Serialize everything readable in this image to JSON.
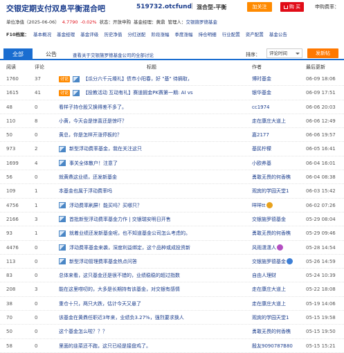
{
  "header": {
    "title": "交银定期支付双息平衡混合吧",
    "code": "519732.otcfund",
    "divider": "|",
    "type": "混合型-平衡",
    "add_label": "加关注",
    "buy_label": "购 买",
    "fee_label": "申购费率："
  },
  "info": {
    "nav_label": "单位净值（2025-06-06）",
    "nav_value": "4.7790",
    "change": "-0.02%",
    "status": "状态：开放申购",
    "manager": "基金经理：黄鼎",
    "company_label": "管理人：",
    "company": "交银施罗德基金"
  },
  "f10": {
    "label": "F10档案：",
    "links": [
      "基本概况",
      "基金经理",
      "基金评级",
      "历史净值",
      "分红送配",
      "阶段涨幅",
      "季度涨幅",
      "持仓明细",
      "行业配置",
      "资产配置",
      "基金公告"
    ]
  },
  "tabs": {
    "all": "全部",
    "announce": "公告",
    "link": "查看关于交银施罗德基金公司的全部讨论",
    "sort_label": "排序：",
    "sort_value": "评论时间",
    "post": "发新帖"
  },
  "columns": {
    "read": "阅读",
    "comment": "评论",
    "title": "标题",
    "author": "作者",
    "time": "最后更新"
  },
  "rows": [
    {
      "read": "1760",
      "cmt": "37",
      "tag": "讨论",
      "img": true,
      "title": "【瓜分六千元壕礼】债市小阳春，好 \"基\" 待摘取，",
      "author": "博时基金",
      "badge": "",
      "time": "06-09 18:06"
    },
    {
      "read": "1615",
      "cmt": "41",
      "tag": "讨论",
      "img": true,
      "title": "【投教活动 互动有礼】赛道掘金PK赛第一期: AI vs",
      "author": "银华基金",
      "badge": "",
      "time": "06-09 17:51"
    },
    {
      "read": "48",
      "cmt": "0",
      "tag": "",
      "img": false,
      "title": "看样子持仓股又换得差不多了。",
      "author": "cc1974",
      "badge": "",
      "time": "06-06 20:03"
    },
    {
      "read": "110",
      "cmt": "8",
      "tag": "",
      "img": false,
      "title": "小黄，今天会是惊喜还是惊吓？",
      "author": "走在康庄大道上",
      "badge": "",
      "time": "06-06 12:49"
    },
    {
      "read": "50",
      "cmt": "0",
      "tag": "",
      "img": false,
      "title": "黄总，你是怎样开涨停板的？",
      "author": "嘉2177",
      "badge": "",
      "time": "06-06 19:57"
    },
    {
      "read": "973",
      "cmt": "2",
      "tag": "",
      "img": true,
      "title": "新型浮动费率基金，我在关注这只",
      "author": "基民柠檬",
      "badge": "",
      "time": "06-05 16:41"
    },
    {
      "read": "1699",
      "cmt": "4",
      "tag": "",
      "img": true,
      "title": "事关全体散户！注意了",
      "author": "小欧养基",
      "badge": "",
      "time": "06-04 16:01"
    },
    {
      "read": "56",
      "cmt": "0",
      "tag": "",
      "img": false,
      "title": "就黄鼎这业绩，还发新基金",
      "author": "勇敢无畏的何香樵",
      "badge": "",
      "time": "06-04 08:38"
    },
    {
      "read": "109",
      "cmt": "1",
      "tag": "",
      "img": false,
      "title": "本基金也属于浮动费率吗",
      "author": "观宾的学园天堂1",
      "badge": "",
      "time": "06-03 15:42"
    },
    {
      "read": "4756",
      "cmt": "1",
      "tag": "",
      "img": true,
      "title": "浮动费率刷屏！能买吗？买哪只？",
      "author": "咩咩tt",
      "badge": "gold",
      "time": "06-02 07:26"
    },
    {
      "read": "2166",
      "cmt": "3",
      "tag": "",
      "img": true,
      "title": "首批新型浮动费率基金力作 | 交银瑞安明日开售",
      "author": "交银施罗德基金",
      "badge": "",
      "time": "05-29 08:04"
    },
    {
      "read": "93",
      "cmt": "1",
      "tag": "",
      "img": true,
      "title": "就着业绩还发新基金呢，也不知道基金公司怎么考虑的。",
      "author": "勇敢无畏的何香樵",
      "badge": "",
      "time": "05-29 09:46"
    },
    {
      "read": "4476",
      "cmt": "0",
      "tag": "",
      "img": true,
      "title": "浮动费率基金来袭，深度利益绑定，这个品种或成投资新",
      "author": "风雨潇潇人",
      "badge": "purple",
      "time": "05-28 14:54"
    },
    {
      "read": "113",
      "cmt": "0",
      "tag": "",
      "img": true,
      "title": "新型浮动管理费率基金热点问答",
      "author": "交银施罗德基金",
      "badge": "blue",
      "time": "05-26 14:59"
    },
    {
      "read": "83",
      "cmt": "0",
      "tag": "",
      "img": false,
      "title": "总体来看，这只基金还是很不错的，业绩稳稳的超过指数",
      "author": "自由人理财",
      "badge": "",
      "time": "05-24 10:39"
    },
    {
      "read": "208",
      "cmt": "3",
      "tag": "",
      "img": false,
      "title": "能在这里唠叨的，大多是长期持有该基金，对交银有感情",
      "author": "走在康庄大道上",
      "badge": "",
      "time": "05-22 18:08"
    },
    {
      "read": "38",
      "cmt": "0",
      "tag": "",
      "img": false,
      "title": "重仓十只，两只大跌，估计今天又悬了",
      "author": "走在康庄大道上",
      "badge": "",
      "time": "05-19 14:06"
    },
    {
      "read": "70",
      "cmt": "0",
      "tag": "",
      "img": false,
      "title": "该基金在黄鼎任职近3年来，业绩负3.27%，强烈要求换人",
      "author": "观宾的学园天堂1",
      "badge": "",
      "time": "05-15 19:58"
    },
    {
      "read": "50",
      "cmt": "0",
      "tag": "",
      "img": false,
      "title": "这个基金怎么啦？？？",
      "author": "勇敢无畏的何香樵",
      "badge": "",
      "time": "05-15 19:50"
    },
    {
      "read": "58",
      "cmt": "0",
      "tag": "",
      "img": false,
      "title": "里面的韭菜还不跑，这只已经是接盘鸡了。",
      "author": "殷友9090787B80",
      "badge": "",
      "time": "05-15 15:21"
    }
  ]
}
